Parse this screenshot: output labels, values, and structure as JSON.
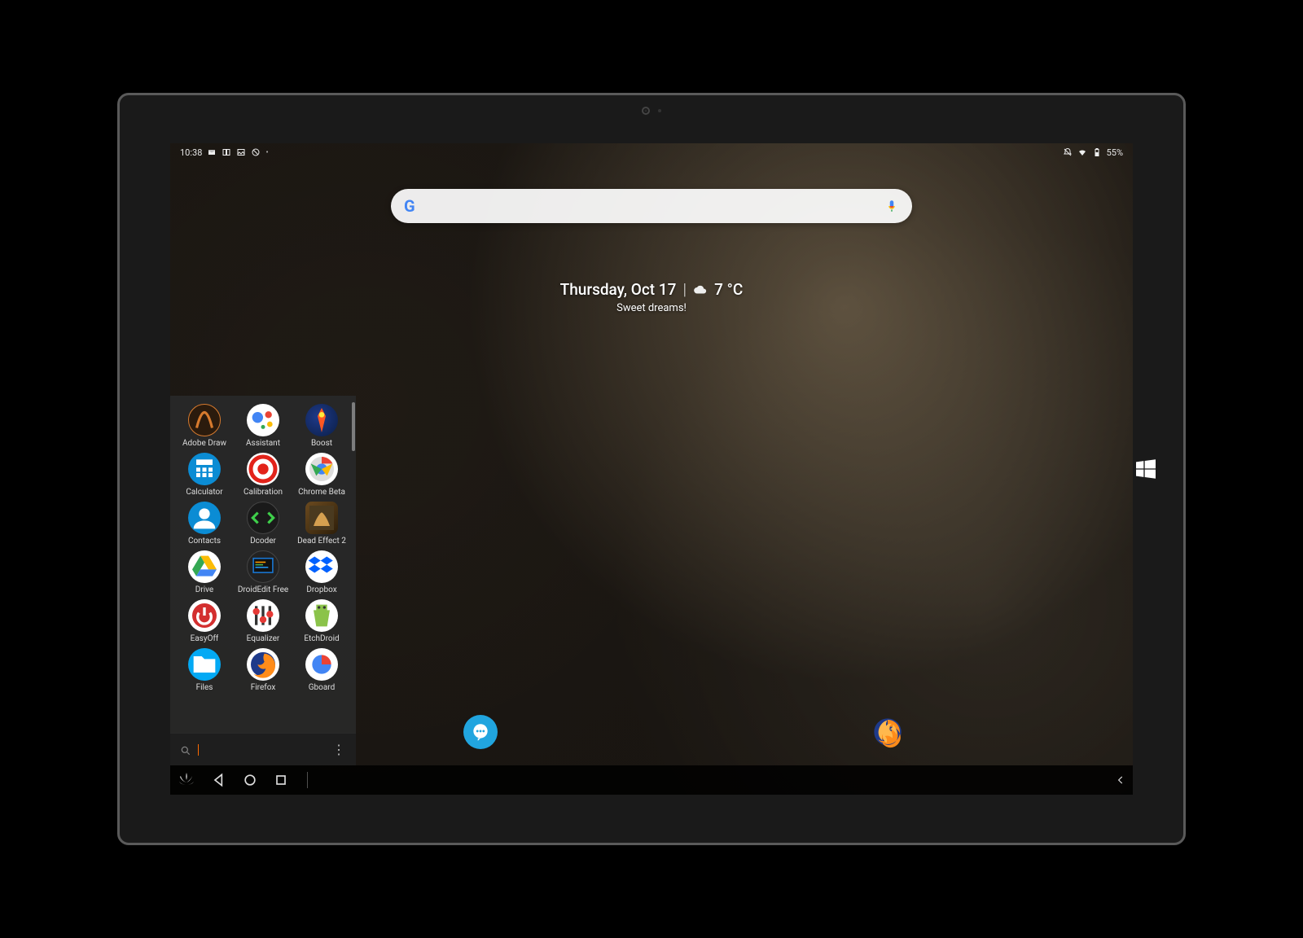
{
  "statusbar": {
    "time": "10:38",
    "battery_label": "55%",
    "icons_left": [
      "mail-icon",
      "image-panel-icon",
      "picture-icon",
      "sync-off-icon",
      "dot-icon"
    ],
    "icons_right": [
      "dnd-icon",
      "wifi-icon",
      "battery-icon"
    ]
  },
  "search": {
    "provider": "Google",
    "mic_label": "voice-search"
  },
  "date_widget": {
    "day": "Thursday, Oct 17",
    "temp": "7 °C",
    "greeting": "Sweet dreams!"
  },
  "drawer": {
    "apps": [
      {
        "label": "Adobe Draw",
        "icon": "adobe-draw-icon",
        "cls": "ic-adobe"
      },
      {
        "label": "Assistant",
        "icon": "assistant-icon",
        "cls": "ic-assist"
      },
      {
        "label": "Boost",
        "icon": "boost-icon",
        "cls": "ic-boost"
      },
      {
        "label": "Calculator",
        "icon": "calculator-icon",
        "cls": "ic-calc"
      },
      {
        "label": "Calibration",
        "icon": "calibration-icon",
        "cls": "ic-calib"
      },
      {
        "label": "Chrome Beta",
        "icon": "chrome-beta-icon",
        "cls": "ic-chrome"
      },
      {
        "label": "Contacts",
        "icon": "contacts-icon",
        "cls": "ic-contacts"
      },
      {
        "label": "Dcoder",
        "icon": "dcoder-icon",
        "cls": "ic-dcoder"
      },
      {
        "label": "Dead Effect 2",
        "icon": "dead-effect-icon",
        "cls": "ic-deadfx"
      },
      {
        "label": "Drive",
        "icon": "drive-icon",
        "cls": "ic-drive"
      },
      {
        "label": "DroidEdit Free",
        "icon": "droidedit-icon",
        "cls": "ic-droidedit"
      },
      {
        "label": "Dropbox",
        "icon": "dropbox-icon",
        "cls": "ic-dropbox"
      },
      {
        "label": "EasyOff",
        "icon": "easyoff-icon",
        "cls": "ic-easyoff"
      },
      {
        "label": "Equalizer",
        "icon": "equalizer-icon",
        "cls": "ic-eq"
      },
      {
        "label": "EtchDroid",
        "icon": "etchdroid-icon",
        "cls": "ic-etch"
      },
      {
        "label": "Files",
        "icon": "files-icon",
        "cls": "ic-files"
      },
      {
        "label": "Firefox",
        "icon": "firefox-icon",
        "cls": "ic-firefox"
      },
      {
        "label": "Gboard",
        "icon": "gboard-icon",
        "cls": "ic-gboard"
      }
    ],
    "search_placeholder": "",
    "more_label": "⋮"
  },
  "taskbar": {
    "items": [
      "launcher-icon",
      "back-icon",
      "home-icon",
      "recents-icon"
    ],
    "right_chevron": "expand-icon"
  },
  "dock": {
    "chat_app": "messages-icon",
    "browser_app": "firefox-icon"
  }
}
